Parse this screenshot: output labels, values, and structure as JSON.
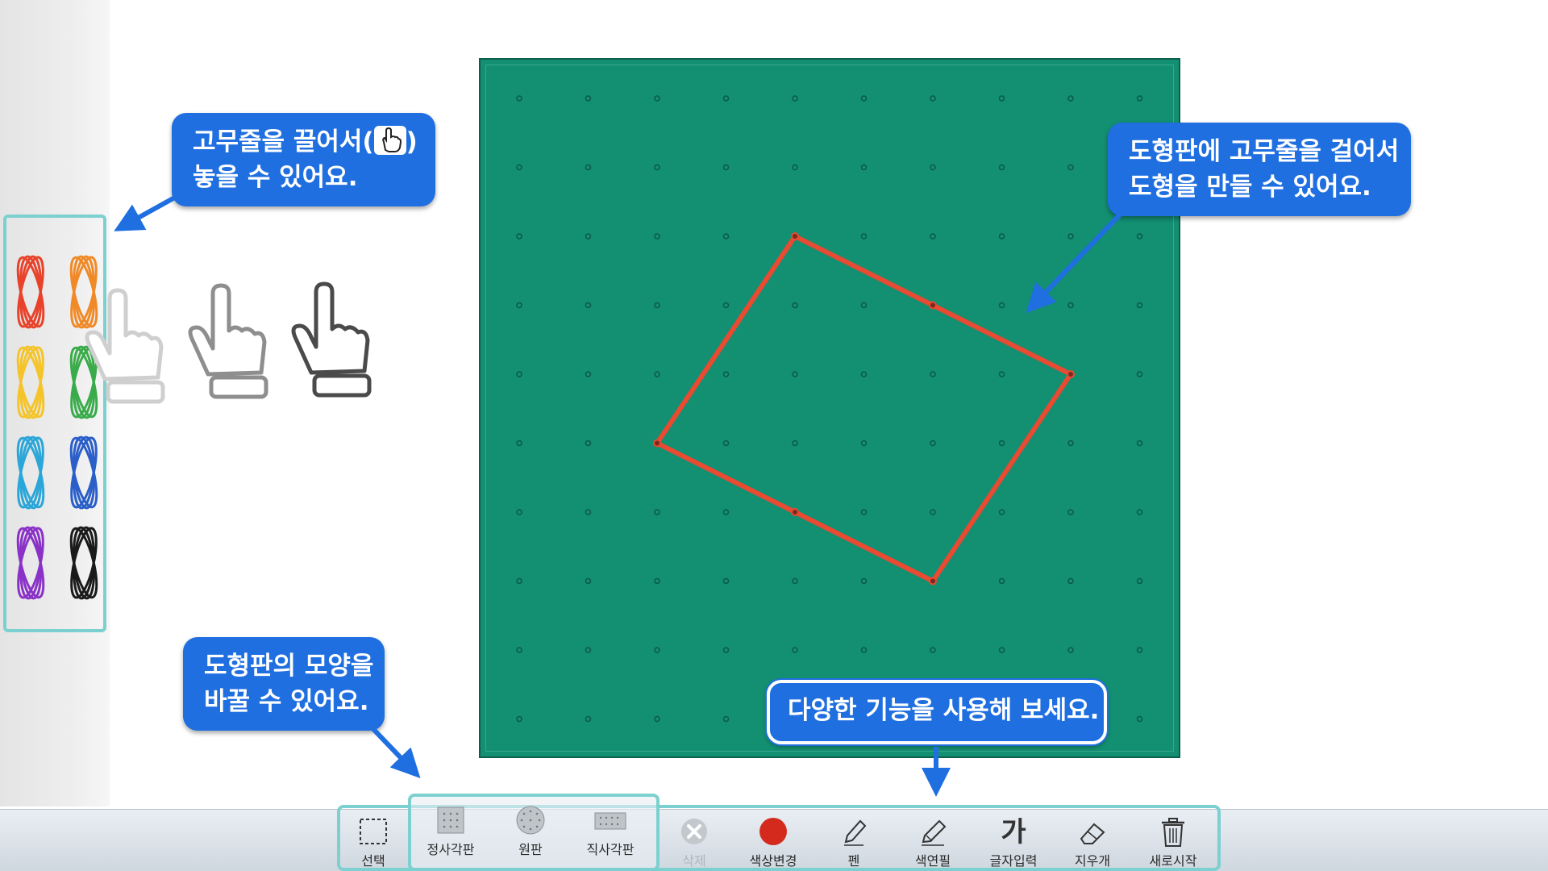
{
  "callouts": {
    "drag_bands": [
      "고무줄을 끌어서(",
      ")",
      "놓을 수 있어요."
    ],
    "make_shapes": [
      "도형판에 고무줄을 걸어서",
      "도형을 만들 수 있어요."
    ],
    "change_board": [
      "도형판의 모양을",
      "바꿀 수 있어요."
    ],
    "use_features": "다양한 기능을 사용해 보세요."
  },
  "palette": {
    "bands": [
      {
        "name": "red",
        "color": "#e8422a"
      },
      {
        "name": "orange",
        "color": "#f08a28"
      },
      {
        "name": "yellow",
        "color": "#f4c42a"
      },
      {
        "name": "green",
        "color": "#3aab4a"
      },
      {
        "name": "sky-blue",
        "color": "#2aa6d8"
      },
      {
        "name": "blue",
        "color": "#2a5ec8"
      },
      {
        "name": "purple",
        "color": "#8a32c8"
      },
      {
        "name": "black",
        "color": "#1a1a1a"
      }
    ]
  },
  "board": {
    "color": "#138f72",
    "grid_cols": 10,
    "grid_rows": 10,
    "band_color": "#e84a32",
    "shape_pegs": [
      [
        4,
        2
      ],
      [
        8,
        4
      ],
      [
        6,
        7
      ],
      [
        2,
        5
      ]
    ],
    "touched_pegs": [
      [
        6,
        3
      ],
      [
        4,
        6
      ]
    ]
  },
  "toolbar": {
    "select": "선택",
    "square_board": "정사각판",
    "circle_board": "원판",
    "rect_board": "직사각판",
    "delete": "삭제",
    "change_color": "색상변경",
    "pen": "펜",
    "color_pencil": "색연필",
    "text_input": "글자입력",
    "text_icon": "가",
    "eraser": "지우개",
    "restart": "새로시작"
  },
  "colors": {
    "accent": "#1f6fe0",
    "highlight": "#7dd0d0",
    "change_color_dot": "#d42a1e"
  }
}
